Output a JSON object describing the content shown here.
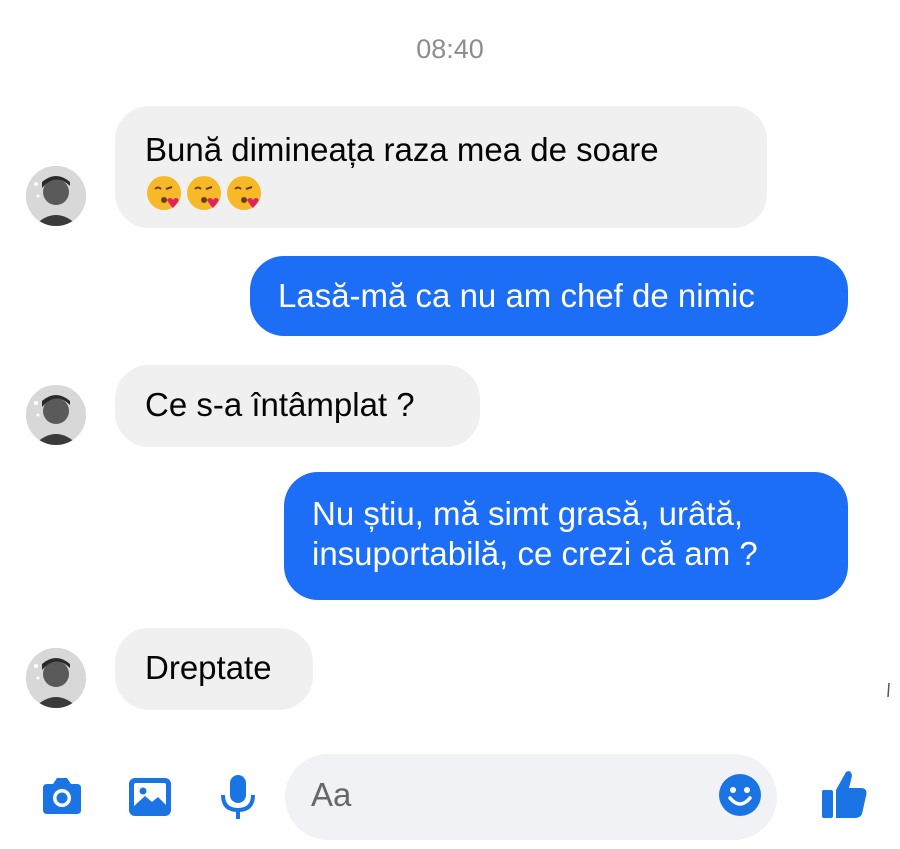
{
  "timestamp": "08:40",
  "messages": [
    {
      "side": "in",
      "text": "Bună dimineața raza mea de soare",
      "emoji": [
        "kiss-heart",
        "kiss-heart",
        "kiss-heart"
      ]
    },
    {
      "side": "out",
      "text": "Lasă-mă ca nu am chef de nimic"
    },
    {
      "side": "in",
      "text": "Ce s-a întâmplat  ?"
    },
    {
      "side": "out",
      "line1": "Nu știu, mă simt grasă, urâtă,",
      "line2": "insuportabilă, ce crezi că am ?"
    },
    {
      "side": "in",
      "text": "Dreptate"
    }
  ],
  "composer": {
    "placeholder": "Aa",
    "icons": [
      "camera-icon",
      "image-icon",
      "microphone-icon",
      "emoji-icon",
      "thumbs-up-icon"
    ]
  },
  "colors": {
    "outgoing_bubble": "#1b6ef5",
    "incoming_bubble": "#f0f0f0",
    "accent_icon": "#1b74e4",
    "timestamp": "#8a8d91"
  }
}
